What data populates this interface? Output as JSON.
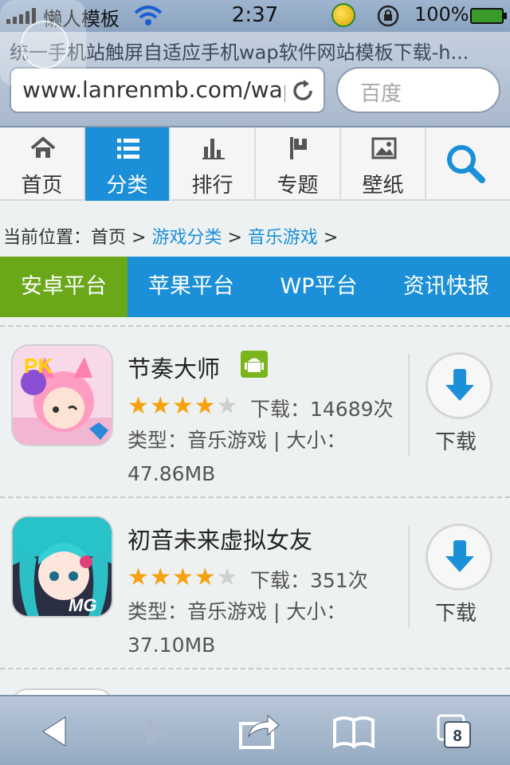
{
  "status": {
    "carrier": "懒人模板",
    "time": "2:37",
    "battery": "100%"
  },
  "browser": {
    "page_title": "统一手机站触屏自适应手机wap软件网站模板下载-h...",
    "url": "www.lanrenmb.com/wap",
    "search_placeholder": "百度"
  },
  "nav": [
    {
      "label": "首页",
      "icon": "home-icon"
    },
    {
      "label": "分类",
      "icon": "list-icon",
      "active": true
    },
    {
      "label": "排行",
      "icon": "bar-chart-icon"
    },
    {
      "label": "专题",
      "icon": "flag-icon"
    },
    {
      "label": "壁纸",
      "icon": "picture-icon"
    }
  ],
  "breadcrumb": {
    "prefix": "当前位置：首页 >",
    "link1": "游戏分类",
    "sep": ">",
    "link2": "音乐游戏",
    "suffix": ">"
  },
  "platform_tabs": [
    {
      "label": "安卓平台",
      "active": true
    },
    {
      "label": "苹果平台"
    },
    {
      "label": "WP平台"
    },
    {
      "label": "资讯快报"
    }
  ],
  "apps": [
    {
      "name": "节奏大师",
      "rating": 4,
      "max_rating": 5,
      "downloads": "下载：14689次",
      "meta": "类型：音乐游戏 | 大小：47.86MB",
      "download_label": "下载"
    },
    {
      "name": "初音未来虚拟女友",
      "rating": 4,
      "max_rating": 5,
      "downloads": "下载：351次",
      "meta": "类型：音乐游戏 | 大小：37.10MB",
      "download_label": "下载"
    }
  ],
  "toolbar": {
    "tab_count": "8"
  },
  "colors": {
    "accent": "#1b8fd8",
    "active_tab": "#6aa81a",
    "star": "#f6a10e"
  }
}
